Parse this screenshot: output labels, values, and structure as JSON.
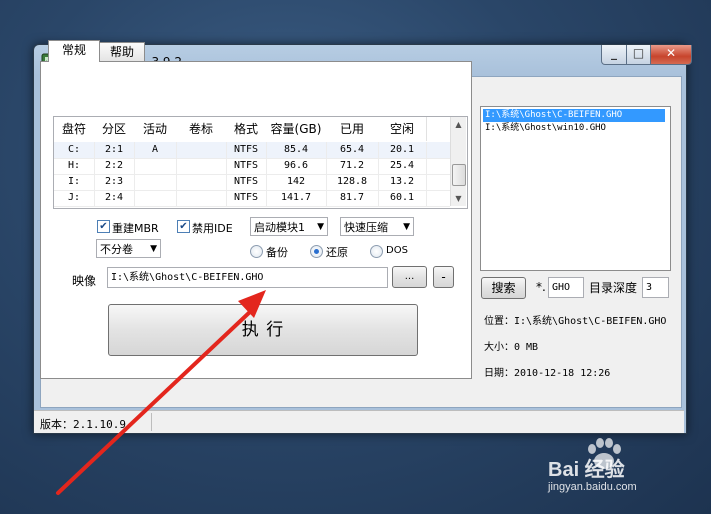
{
  "window": {
    "title": "Ghost安装器 1.3.9.2"
  },
  "tabs": [
    {
      "label": "常规"
    },
    {
      "label": "帮助"
    }
  ],
  "table": {
    "columns": [
      "盘符",
      "分区",
      "活动",
      "卷标",
      "格式",
      "容量(GB)",
      "已用",
      "空闲"
    ],
    "rows": [
      [
        "C:",
        "2:1",
        "A",
        "",
        "NTFS",
        "85.4",
        "65.4",
        "20.1"
      ],
      [
        "H:",
        "2:2",
        "",
        "",
        "NTFS",
        "96.6",
        "71.2",
        "25.4"
      ],
      [
        "I:",
        "2:3",
        "",
        "",
        "NTFS",
        "142",
        "128.8",
        "13.2"
      ],
      [
        "J:",
        "2:4",
        "",
        "",
        "NTFS",
        "141.7",
        "81.7",
        "60.1"
      ]
    ]
  },
  "options": {
    "rebuild_mbr": {
      "label": "重建MBR",
      "checked": true
    },
    "disable_ide": {
      "label": "禁用IDE",
      "checked": true
    },
    "boot_module": "启动模块1",
    "compression": "快速压缩",
    "split": "不分卷",
    "mode": {
      "backup": "备份",
      "restore": "还原",
      "dos": "DOS",
      "selected": "restore"
    }
  },
  "image": {
    "label": "映像",
    "path": "I:\\系统\\Ghost\\C-BEIFEN.GHO",
    "browse_label": "...",
    "minus_label": "-"
  },
  "execute_label": "执    行",
  "right": {
    "files": [
      "I:\\系统\\Ghost\\C-BEIFEN.GHO",
      "I:\\系统\\Ghost\\win10.GHO"
    ],
    "selected_index": 0,
    "search_label": "搜索",
    "ext_prefix": "*.",
    "ext_value": "GHO",
    "depth_label": "目录深度",
    "depth_value": "3",
    "location_label": "位置：",
    "location_value": "I:\\系统\\Ghost\\C-BEIFEN.GHO",
    "size_label": "大小：",
    "size_value": "0 MB",
    "date_label": "日期：",
    "date_value": "2010-12-18   12:26"
  },
  "status": {
    "version": "版本：2.1.10.9"
  },
  "watermark": {
    "brand": "Bai 经验",
    "url": "jingyan.baidu.com"
  },
  "colors": {
    "selection": "#3399ff",
    "arrow": "#e3261d",
    "titlebar": "#b7cde3"
  }
}
